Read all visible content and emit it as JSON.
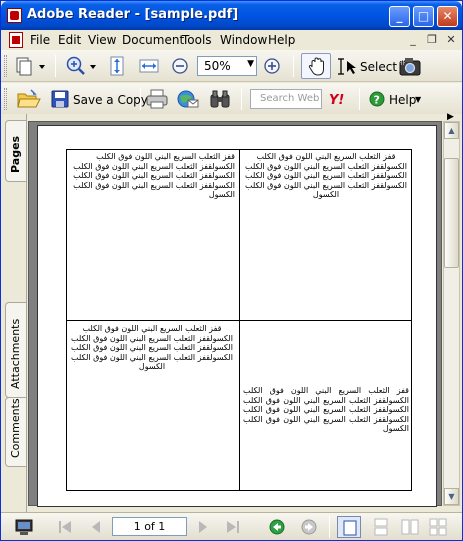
{
  "window": {
    "title": "Adobe Reader - [sample.pdf]",
    "minimize_glyph": "_",
    "maximize_glyph": "□",
    "close_glyph": "✕"
  },
  "menu": {
    "items": [
      "File",
      "Edit",
      "View",
      "Document",
      "Tools",
      "Window",
      "Help"
    ],
    "doc_minimize_glyph": "_",
    "doc_restore_glyph": "❐",
    "doc_close_glyph": "✕"
  },
  "toolbar1": {
    "zoom_value": "50%",
    "select_label": "Select",
    "icons": [
      "pages-icon",
      "zoom-in-icon",
      "fit-height-icon",
      "fit-width-icon",
      "zoom-out-icon",
      "zoom-plus-icon",
      "hand-icon",
      "select-icon",
      "snapshot-icon"
    ]
  },
  "toolbar2": {
    "save_copy_label": "Save a Copy",
    "search_placeholder": "Search Web",
    "help_label": "Help",
    "icons": [
      "open-icon",
      "save-icon",
      "print-icon",
      "email-icon",
      "binoculars-icon",
      "yahoo-icon",
      "help-icon"
    ]
  },
  "sidebar": {
    "tabs": [
      "Pages",
      "Attachments",
      "Comments"
    ]
  },
  "document": {
    "cells": [
      "قفز الثعلب السريع البني اللون فوق الكلب الكسولقفز الثعلب السريع البني اللون فوق الكلب الكسولقفز الثعلب السريع البني اللون فوق الكلب الكسولقفز الثعلب السريع البني اللون فوق الكلب الكسول",
      "قفز الثعلب السريع البني اللون فوق الكلب الكسولقفز الثعلب السريع البني اللون فوق الكلب الكسولقفز الثعلب السريع البني اللون فوق الكلب الكسولقفز الثعلب السريع البني اللون فوق الكلب الكسول",
      "قفز الثعلب السريع البني اللون فوق الكلب الكسولقفز الثعلب السريع البني اللون فوق الكلب الكسولقفز الثعلب السريع البني اللون فوق الكلب الكسولقفز الثعلب السريع البني اللون فوق الكلب الكسول",
      "قفز الثعلب السريع البني اللون فوق الكلب الكسولقفز الثعلب السريع البني اللون فوق الكلب الكسولقفز الثعلب السريع البني اللون فوق الكلب الكسولقفز الثعلب السريع البني اللون فوق الكلب الكسول"
    ]
  },
  "statusbar": {
    "page_indicator": "1 of 1"
  },
  "colors": {
    "titlebar": "#0054e3",
    "doc_background": "#808080",
    "window_bg": "#ece9d8"
  }
}
